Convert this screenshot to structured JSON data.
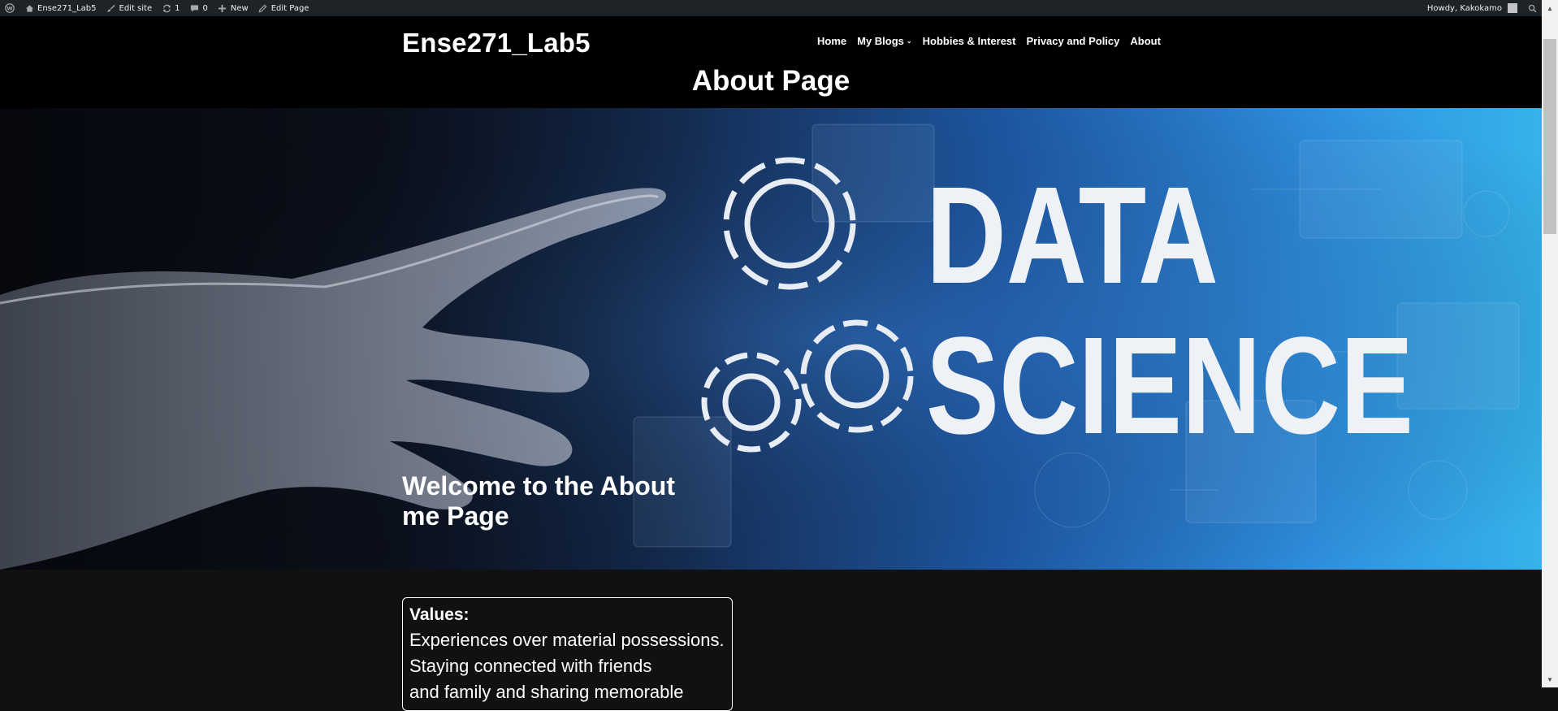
{
  "admin_bar": {
    "site_name": "Ense271_Lab5",
    "edit_site": "Edit site",
    "updates_count": "1",
    "comments_count": "0",
    "new_label": "New",
    "edit_page": "Edit Page",
    "howdy": "Howdy, Kakokamo"
  },
  "header": {
    "site_title": "Ense271_Lab5",
    "nav": [
      {
        "label": "Home"
      },
      {
        "label": "My Blogs"
      },
      {
        "label": "Hobbies & Interest"
      },
      {
        "label": "Privacy and Policy"
      },
      {
        "label": "About"
      }
    ],
    "page_title": "About Page"
  },
  "hero": {
    "image_text_line1": "DATA",
    "image_text_line2": "SCIENCE",
    "heading": "Welcome to the About me Page"
  },
  "values": {
    "title": "Values:",
    "lines": [
      "Experiences over material possessions.",
      "Staying connected with friends",
      "and family and sharing memorable"
    ]
  }
}
